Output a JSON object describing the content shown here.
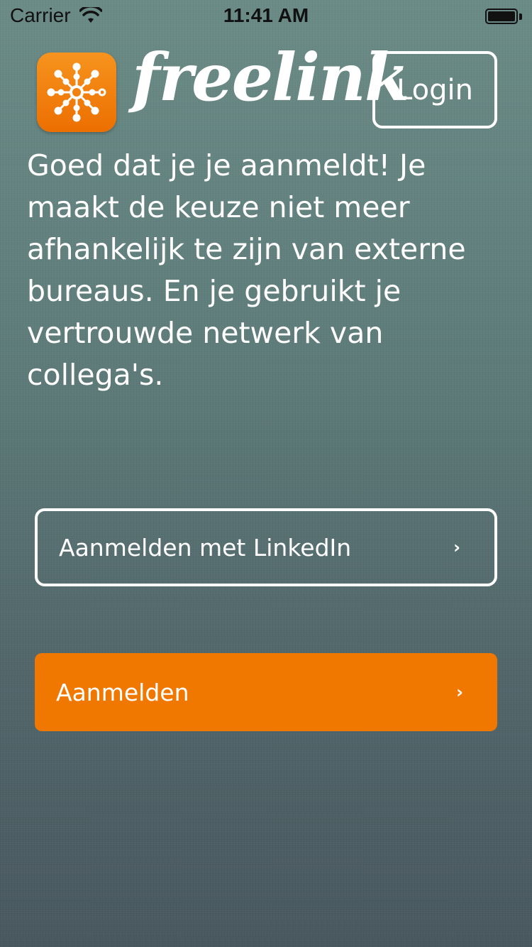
{
  "status_bar": {
    "carrier": "Carrier",
    "time": "11:41 AM",
    "wifi_icon": "wifi-icon",
    "battery_icon": "battery-icon",
    "battery_level": 1.0
  },
  "header": {
    "logo_icon": "freelink-network-icon",
    "wordmark": "freelink",
    "login_label": "Login"
  },
  "intro": {
    "text": "Goed dat je je aanmeldt! Je maakt de keuze niet meer afhankelijk te zijn van externe bureaus. En je gebruikt je vertrouwde netwerk van collega's."
  },
  "actions": {
    "linkedin_label": "Aanmelden met LinkedIn",
    "register_label": "Aanmelden",
    "chevron": "›"
  },
  "colors": {
    "accent": "#f07800",
    "logo_gradient_top": "#f7931e",
    "logo_gradient_bottom": "#ec6f00",
    "background_top": "#6b8b86",
    "background_bottom": "#49585f",
    "text": "#ffffff"
  }
}
